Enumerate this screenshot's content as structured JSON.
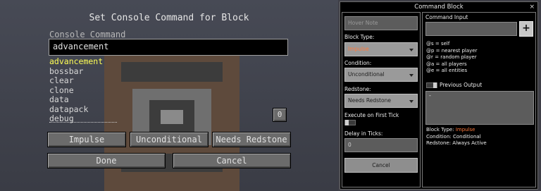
{
  "left": {
    "title": "Set Console Command for Block",
    "console_label": "Console Command",
    "command_value": "advancement",
    "suggestions": [
      "advancement",
      "bossbar",
      "clear",
      "clone",
      "data",
      "datapack",
      "debug"
    ],
    "count_button": "0",
    "buttons": {
      "impulse": "Impulse",
      "unconditional": "Unconditional",
      "needs_redstone": "Needs Redstone",
      "done": "Done",
      "cancel": "Cancel"
    }
  },
  "right": {
    "window_title": "Command Block",
    "close": "×",
    "hover_note_placeholder": "Hover Note",
    "block_type_label": "Block Type:",
    "block_type_value": "Impulse",
    "condition_label": "Condition:",
    "condition_value": "Unconditional",
    "redstone_label": "Redstone:",
    "redstone_value": "Needs Redstone",
    "execute_first_tick_label": "Execute on First Tick",
    "delay_label": "Delay in Ticks:",
    "delay_value": "0",
    "cancel": "Cancel",
    "command_input_label": "Command Input",
    "plus": "+",
    "help_lines": [
      "@s = self",
      "@p = nearest player",
      "@r = random player",
      "@a = all players",
      "@e = all entities"
    ],
    "previous_output_label": "Previous Output",
    "output_value": "-",
    "info_block_type_label": "Block Type: ",
    "info_block_type_value": "Impulse",
    "info_condition": "Condition: Conditional",
    "info_redstone": "Redstone: Always Active"
  },
  "colors": {
    "suggestion_highlight": "#ffff55",
    "accent_orange": "#ff7a3c"
  }
}
